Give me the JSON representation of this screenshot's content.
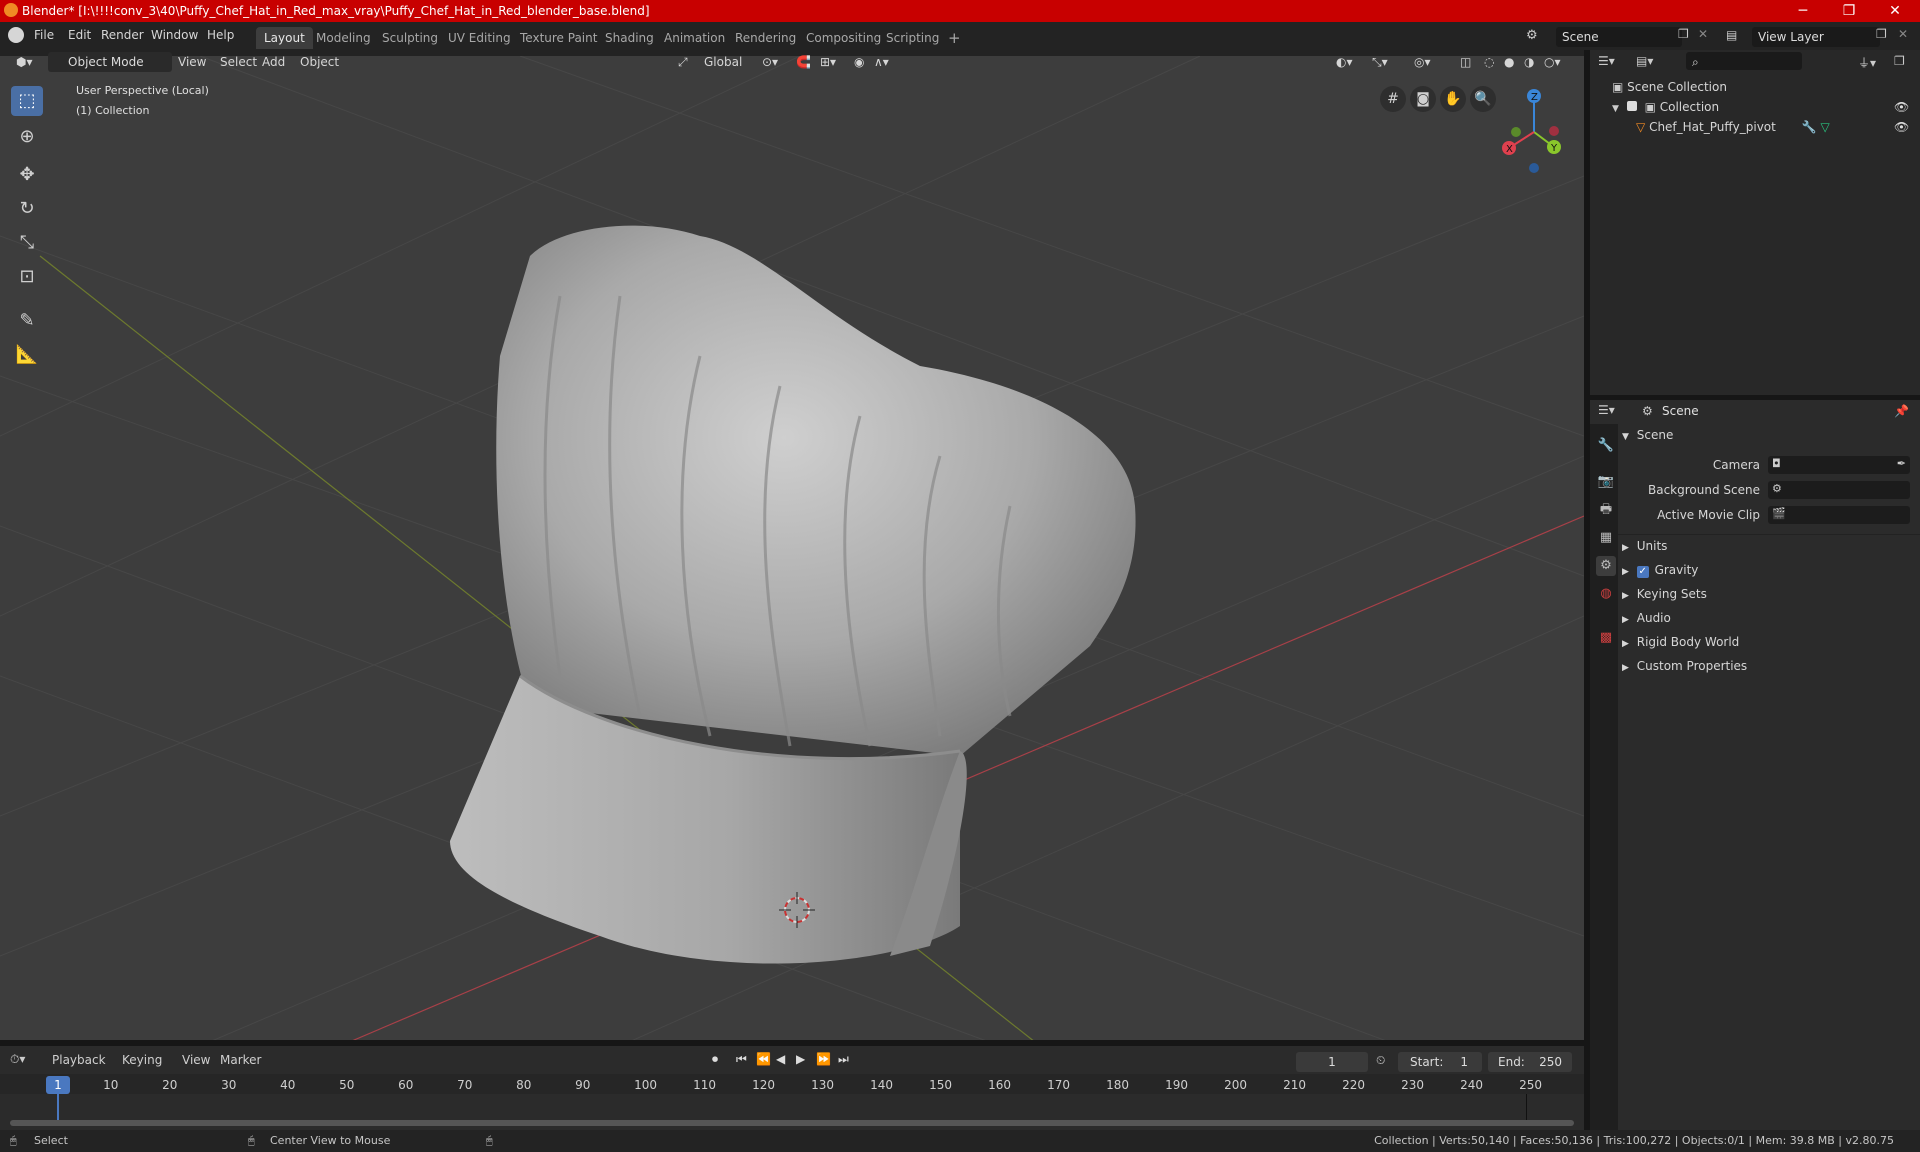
{
  "window": {
    "title": "Blender* [I:\\!!!!conv_3\\40\\Puffy_Chef_Hat_in_Red_max_vray\\Puffy_Chef_Hat_in_Red_blender_base.blend]",
    "minimize": "─",
    "maximize": "❐",
    "close": "✕"
  },
  "menubar": {
    "items": [
      "File",
      "Edit",
      "Render",
      "Window",
      "Help"
    ]
  },
  "workspaces": {
    "tabs": [
      "Layout",
      "Modeling",
      "Sculpting",
      "UV Editing",
      "Texture Paint",
      "Shading",
      "Animation",
      "Rendering",
      "Compositing",
      "Scripting"
    ],
    "add": "+"
  },
  "scene_selector": {
    "value": "Scene"
  },
  "view_layer_selector": {
    "value": "View Layer"
  },
  "viewport_header": {
    "mode": "Object Mode",
    "menus": [
      "View",
      "Select",
      "Add",
      "Object"
    ],
    "transform_orientation": "Global"
  },
  "viewport": {
    "info_line1": "User Perspective (Local)",
    "info_line2": "(1) Collection",
    "gizmo": {
      "x": "X",
      "y": "Y",
      "z": "Z"
    }
  },
  "outliner": {
    "root": "Scene Collection",
    "collection": "Collection",
    "object": "Chef_Hat_Puffy_pivot",
    "search_placeholder": ""
  },
  "properties": {
    "header_title": "Scene",
    "section_title": "Scene",
    "fields": [
      {
        "label": "Camera"
      },
      {
        "label": "Background Scene"
      },
      {
        "label": "Active Movie Clip"
      }
    ],
    "panels": [
      "Units",
      "Gravity",
      "Keying Sets",
      "Audio",
      "Rigid Body World",
      "Custom Properties"
    ],
    "gravity_checked": true
  },
  "timeline": {
    "menus": [
      "Playback",
      "Keying",
      "View",
      "Marker"
    ],
    "current_frame": "1",
    "start_label": "Start:",
    "start_value": "1",
    "end_label": "End:",
    "end_value": "250",
    "ticks": [
      "1",
      "10",
      "20",
      "30",
      "40",
      "50",
      "60",
      "70",
      "80",
      "90",
      "100",
      "110",
      "120",
      "130",
      "140",
      "150",
      "160",
      "170",
      "180",
      "190",
      "200",
      "210",
      "220",
      "230",
      "240",
      "250"
    ]
  },
  "statusbar": {
    "left": "Select",
    "middle": "Center View to Mouse",
    "right": "Collection | Verts:50,140 | Faces:50,136 | Tris:100,272 | Objects:0/1 | Mem: 39.8 MB | v2.80.75"
  },
  "colors": {
    "title_bar": "#c80000",
    "viewport_bg": "#3d3d3d",
    "active_blue": "#4a6fa5",
    "axis_x": "#e0404e",
    "axis_y": "#8ac72b",
    "axis_z": "#3a86d8"
  }
}
